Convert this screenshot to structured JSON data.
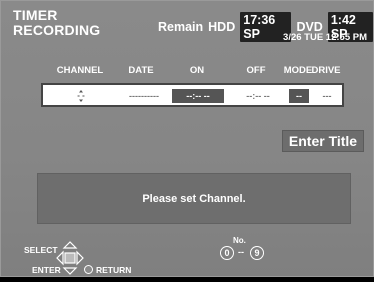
{
  "header": {
    "title_line1": "TIMER",
    "title_line2": "RECORDING",
    "remain_label": "Remain",
    "hdd_label": "HDD",
    "hdd_time": "17:36 SP",
    "dvd_label": "DVD",
    "dvd_time": "1:42 SP",
    "datetime": "3/26 TUE 12:55 PM"
  },
  "table": {
    "columns": [
      "CHANNEL",
      "DATE",
      "ON",
      "OFF",
      "MODE",
      "DRIVE"
    ],
    "row": {
      "channel": "- -",
      "date": "----------",
      "on": "--:-- --",
      "off": "--:-- --",
      "mode": "--",
      "drive": "---"
    }
  },
  "enter_title_label": "Enter Title",
  "message": "Please set Channel.",
  "footer": {
    "select_label": "SELECT",
    "enter_label": "ENTER",
    "return_label": "RETURN",
    "no_label": "No.",
    "num_start": "0",
    "num_dash": "--",
    "num_end": "9"
  }
}
